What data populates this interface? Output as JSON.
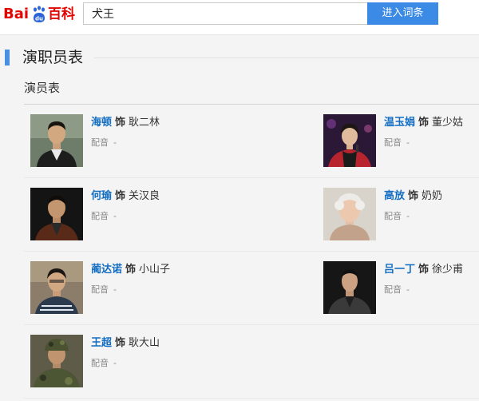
{
  "logo": {
    "bai": "Bai",
    "du": "du",
    "baike": "百科"
  },
  "search": {
    "value": "犬王",
    "button_label": "进入词条"
  },
  "section": {
    "title": "演职员表",
    "subtitle": "演员表"
  },
  "cast": [
    {
      "actor": "海顿",
      "role_word": "饰",
      "role": "耿二林",
      "dub_label": "配音",
      "dub_value": "-"
    },
    {
      "actor": "温玉娟",
      "role_word": "饰",
      "role": "董少姑",
      "dub_label": "配音",
      "dub_value": "-"
    },
    {
      "actor": "何瑜",
      "role_word": "饰",
      "role": "关汉良",
      "dub_label": "配音",
      "dub_value": "-"
    },
    {
      "actor": "高放",
      "role_word": "饰",
      "role": "奶奶",
      "dub_label": "配音",
      "dub_value": "-"
    },
    {
      "actor": "蔺达诺",
      "role_word": "饰",
      "role": "小山子",
      "dub_label": "配音",
      "dub_value": "-"
    },
    {
      "actor": "吕一丁",
      "role_word": "饰",
      "role": "徐少甫",
      "dub_label": "配音",
      "dub_value": "-"
    },
    {
      "actor": "王超",
      "role_word": "饰",
      "role": "耿大山",
      "dub_label": "配音",
      "dub_value": "-"
    }
  ]
}
